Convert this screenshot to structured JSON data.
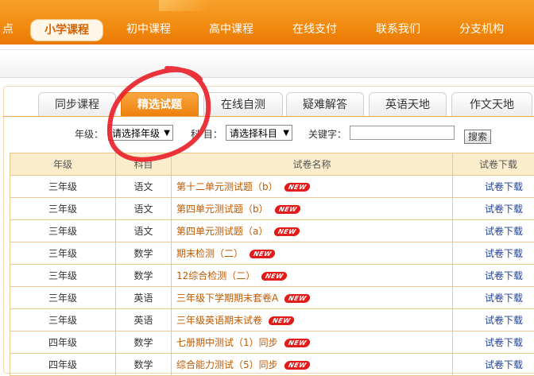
{
  "nav": {
    "items": [
      {
        "label": "点"
      },
      {
        "label": "小学课程"
      },
      {
        "label": "初中课程"
      },
      {
        "label": "高中课程"
      },
      {
        "label": "在线支付"
      },
      {
        "label": "联系我们"
      },
      {
        "label": "分支机构"
      }
    ]
  },
  "tabs": [
    {
      "label": "同步课程"
    },
    {
      "label": "精选试题"
    },
    {
      "label": "在线自测"
    },
    {
      "label": "疑难解答"
    },
    {
      "label": "英语天地"
    },
    {
      "label": "作文天地"
    }
  ],
  "filters": {
    "grade_label": "年级：",
    "grade_value": "请选择年级",
    "subject_label": "科 目：",
    "subject_value": "请选择科目",
    "keyword_label": "关键字：",
    "keyword_value": "",
    "search_label": "搜索"
  },
  "table": {
    "headers": [
      "年级",
      "科目",
      "试卷名称",
      "试卷下载"
    ],
    "new_badge": "NEW",
    "rows": [
      {
        "grade": "三年级",
        "subject": "语文",
        "name": "第十二单元测试题（b）",
        "download": "试卷下载"
      },
      {
        "grade": "三年级",
        "subject": "语文",
        "name": "第四单元测试题（b）",
        "download": "试卷下载"
      },
      {
        "grade": "三年级",
        "subject": "语文",
        "name": "第四单元测试题（a）",
        "download": "试卷下载"
      },
      {
        "grade": "三年级",
        "subject": "数学",
        "name": "期末检测（二）",
        "download": "试卷下载"
      },
      {
        "grade": "三年级",
        "subject": "数学",
        "name": "12综合检测（二）",
        "download": "试卷下载"
      },
      {
        "grade": "三年级",
        "subject": "英语",
        "name": "三年级下学期期末套卷A",
        "download": "试卷下载"
      },
      {
        "grade": "三年级",
        "subject": "英语",
        "name": "三年级英语期末试卷",
        "download": "试卷下载"
      },
      {
        "grade": "四年级",
        "subject": "数学",
        "name": "七册期中测试（1）同步",
        "download": "试卷下载"
      },
      {
        "grade": "四年级",
        "subject": "数学",
        "name": "综合能力测试（5）同步",
        "download": "试卷下载"
      }
    ]
  },
  "colors": {
    "accent": "#f28a10",
    "annotation": "#e8222a",
    "link": "#1f3f9a"
  }
}
